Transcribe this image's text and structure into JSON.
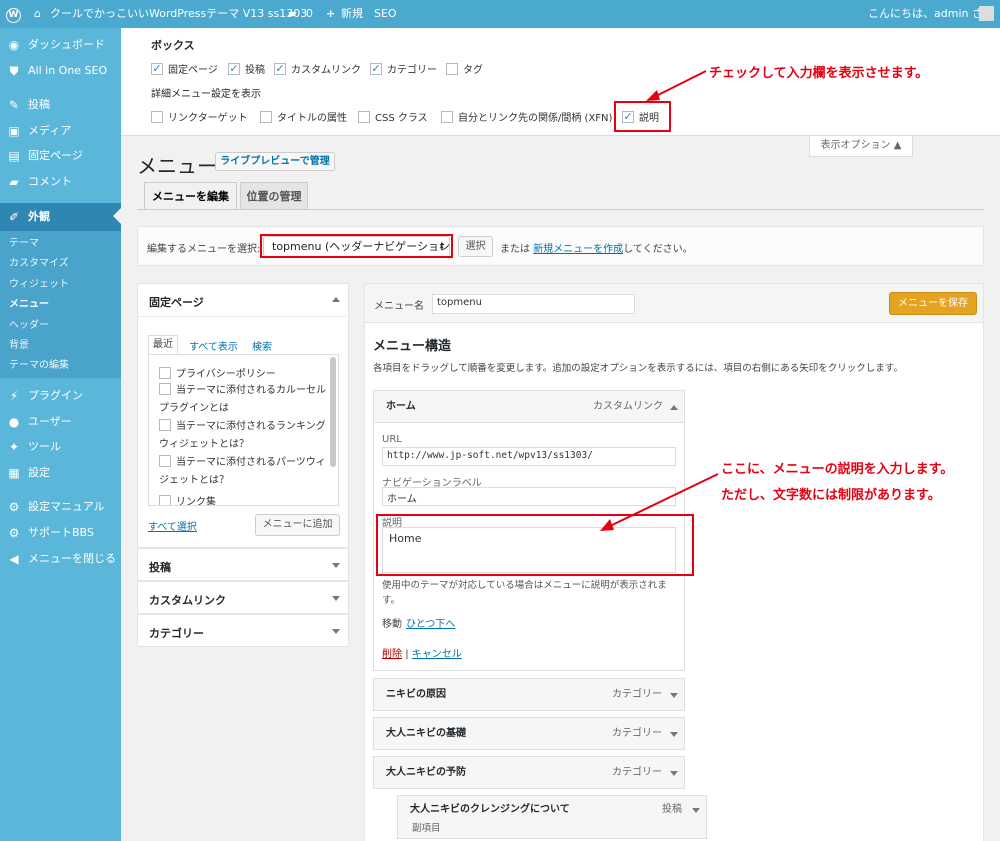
{
  "adminbar": {
    "site_name": "クールでかっこいいWordPressテーマ V13 ss1303",
    "comments_count": "0",
    "new_label": "新規",
    "seo_label": "SEO",
    "greeting": "こんにちは、admin さん"
  },
  "sidebar": {
    "items": [
      {
        "label": "ダッシュボード",
        "icon": "dashboard-icon",
        "glyph": "◉"
      },
      {
        "label": "All in One SEO",
        "icon": "shield-icon",
        "glyph": "⛊"
      },
      {
        "label": "投稿",
        "icon": "pin-icon",
        "glyph": "✎"
      },
      {
        "label": "メディア",
        "icon": "media-icon",
        "glyph": "▣"
      },
      {
        "label": "固定ページ",
        "icon": "page-icon",
        "glyph": "▤"
      },
      {
        "label": "コメント",
        "icon": "comment-icon",
        "glyph": "▰"
      },
      {
        "label": "外観",
        "icon": "appearance-icon",
        "glyph": "✐"
      },
      {
        "label": "プラグイン",
        "icon": "plugin-icon",
        "glyph": "⚡"
      },
      {
        "label": "ユーザー",
        "icon": "user-icon",
        "glyph": "●"
      },
      {
        "label": "ツール",
        "icon": "tool-icon",
        "glyph": "✦"
      },
      {
        "label": "設定",
        "icon": "settings-icon",
        "glyph": "▦"
      },
      {
        "label": "設定マニュアル",
        "icon": "gear-icon",
        "glyph": "⚙"
      },
      {
        "label": "サポートBBS",
        "icon": "gear-icon",
        "glyph": "⚙"
      },
      {
        "label": "メニューを閉じる",
        "icon": "collapse-icon",
        "glyph": "◀"
      }
    ],
    "submenu": [
      "テーマ",
      "カスタマイズ",
      "ウィジェット",
      "メニュー",
      "ヘッダー",
      "背景",
      "テーマの編集"
    ]
  },
  "screen_options": {
    "boxes_heading": "ボックス",
    "boxes": [
      {
        "label": "固定ページ",
        "checked": true
      },
      {
        "label": "投稿",
        "checked": true
      },
      {
        "label": "カスタムリンク",
        "checked": true
      },
      {
        "label": "カテゴリー",
        "checked": true
      },
      {
        "label": "タグ",
        "checked": false
      }
    ],
    "advanced_heading": "詳細メニュー設定を表示",
    "advanced": [
      {
        "label": "リンクターゲット",
        "checked": false
      },
      {
        "label": "タイトルの属性",
        "checked": false
      },
      {
        "label": "CSS クラス",
        "checked": false
      },
      {
        "label": "自分とリンク先の関係/間柄 (XFN)",
        "checked": false
      },
      {
        "label": "説明",
        "checked": true
      }
    ],
    "tab_label": "表示オプション ▲"
  },
  "annotations": {
    "top": "チェックして入力欄を表示させます。",
    "mid1": "ここに、メニューの説明を入力します。",
    "mid2": "ただし、文字数には制限があります。"
  },
  "header": {
    "title": "メニュー",
    "live_preview": "ライブプレビューで管理"
  },
  "tabs": [
    "メニューを編集",
    "位置の管理"
  ],
  "select_menu": {
    "label": "編集するメニューを選択:",
    "value": "topmenu (ヘッダーナビゲーション)",
    "select_button": "選択",
    "or_text": "または",
    "create_link": "新規メニューを作成",
    "suffix": "してください。"
  },
  "left": {
    "pages_title": "固定ページ",
    "subtabs": [
      "最近",
      "すべて表示",
      "検索"
    ],
    "pages": [
      "プライバシーポリシー",
      "当テーマに添付されるカルーセルプラグインとは",
      "当テーマに添付されるランキングウィジェットとは？",
      "当テーマに添付されるパーツウィジェットとは？",
      "リンク集"
    ],
    "select_all": "すべて選択",
    "add_button": "メニューに追加",
    "collapsed": [
      "投稿",
      "カスタムリンク",
      "カテゴリー"
    ]
  },
  "right": {
    "menu_name_label": "メニュー名",
    "menu_name_value": "topmenu",
    "save_button": "メニューを保存",
    "structure_title": "メニュー構造",
    "structure_desc": "各項目をドラッグして順番を変更します。追加の設定オプションを表示するには、項目の右側にある矢印をクリックします。",
    "home_item": {
      "title": "ホーム",
      "type": "カスタムリンク",
      "url_label": "URL",
      "url_value": "http://www.jp-soft.net/wpv13/ss1303/",
      "nav_label": "ナビゲーションラベル",
      "nav_value": "ホーム",
      "desc_label": "説明",
      "desc_value": "Home",
      "desc_help": "使用中のテーマが対応している場合はメニューに説明が表示されます。",
      "move_label": "移動",
      "move_link": "ひとつ下へ",
      "delete": "削除",
      "sep": "|",
      "cancel": "キャンセル"
    },
    "items": [
      {
        "title": "ニキビの原因",
        "type": "カテゴリー"
      },
      {
        "title": "大人ニキビの基礎",
        "type": "カテゴリー"
      },
      {
        "title": "大人ニキビの予防",
        "type": "カテゴリー"
      }
    ],
    "sub_item": {
      "title": "大人ニキビのクレンジングについて",
      "type": "投稿",
      "sub_label": "副項目"
    }
  }
}
